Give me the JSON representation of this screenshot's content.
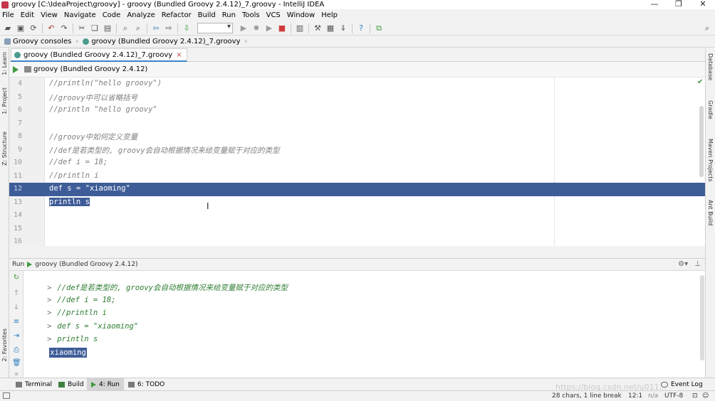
{
  "window": {
    "title": "groovy [C:\\IdeaProject\\groovy] - groovy (Bundled Groovy 2.4.12)_7.groovy - IntelliJ IDEA",
    "controls": [
      "—",
      "❐",
      "✕"
    ]
  },
  "menu": [
    "File",
    "Edit",
    "View",
    "Navigate",
    "Code",
    "Analyze",
    "Refactor",
    "Build",
    "Run",
    "Tools",
    "VCS",
    "Window",
    "Help"
  ],
  "breadcrumb": [
    "Groovy consoles",
    "groovy (Bundled Groovy 2.4.12)_7.groovy"
  ],
  "tab": {
    "label": "groovy (Bundled Groovy 2.4.12)_7.groovy",
    "close": "×"
  },
  "run_config": {
    "label": "groovy (Bundled Groovy 2.4.12)"
  },
  "left_tools": [
    "1: Learn",
    "1: Project",
    "Z: Structure",
    "2: Favorites"
  ],
  "right_tools": [
    "Database",
    "Gradle",
    "Maven Projects",
    "Ant Build"
  ],
  "editor": {
    "lines": [
      {
        "num": "4",
        "code": "//println(\"hello groovy\")"
      },
      {
        "num": "5",
        "code": "//groovy中可以省略括号"
      },
      {
        "num": "6",
        "code": "//println \"hello groovy\""
      },
      {
        "num": "7",
        "code": ""
      },
      {
        "num": "8",
        "code": "//groovy中如何定义变量"
      },
      {
        "num": "9",
        "code": "//def是若类型的, groovy会自动根据情况来给变量赋于对应的类型"
      },
      {
        "num": "10",
        "code": "//def i = 18;"
      },
      {
        "num": "11",
        "code": "//println i"
      },
      {
        "num": "12",
        "code": "def s = \"xiaoming\""
      },
      {
        "num": "13",
        "code": "println s"
      },
      {
        "num": "14",
        "code": ""
      },
      {
        "num": "15",
        "code": ""
      },
      {
        "num": "16",
        "code": ""
      }
    ]
  },
  "run_panel": {
    "header": "groovy (Bundled Groovy 2.4.12)",
    "title": "Run",
    "console": [
      {
        "prompt": ">",
        "text": "//def是若类型的, groovy会自动根据情况来给变量赋于对应的类型"
      },
      {
        "prompt": ">",
        "text": "//def i = 18;"
      },
      {
        "prompt": ">",
        "text": "//println i"
      },
      {
        "prompt": ">",
        "text": "def s = \"xiaoming\""
      },
      {
        "prompt": ">",
        "text": "println s"
      },
      {
        "prompt": "",
        "text": "xiaoming"
      }
    ]
  },
  "bottom_tabs": [
    "Terminal",
    "Build",
    "4: Run",
    "6: TODO"
  ],
  "event_log": "Event Log",
  "status": {
    "chars": "28 chars, 1 line break",
    "position": "12:1",
    "separator": "n/a",
    "encoding": "UTF-8"
  },
  "watermark": "https://blog.csdn.net/u011..."
}
